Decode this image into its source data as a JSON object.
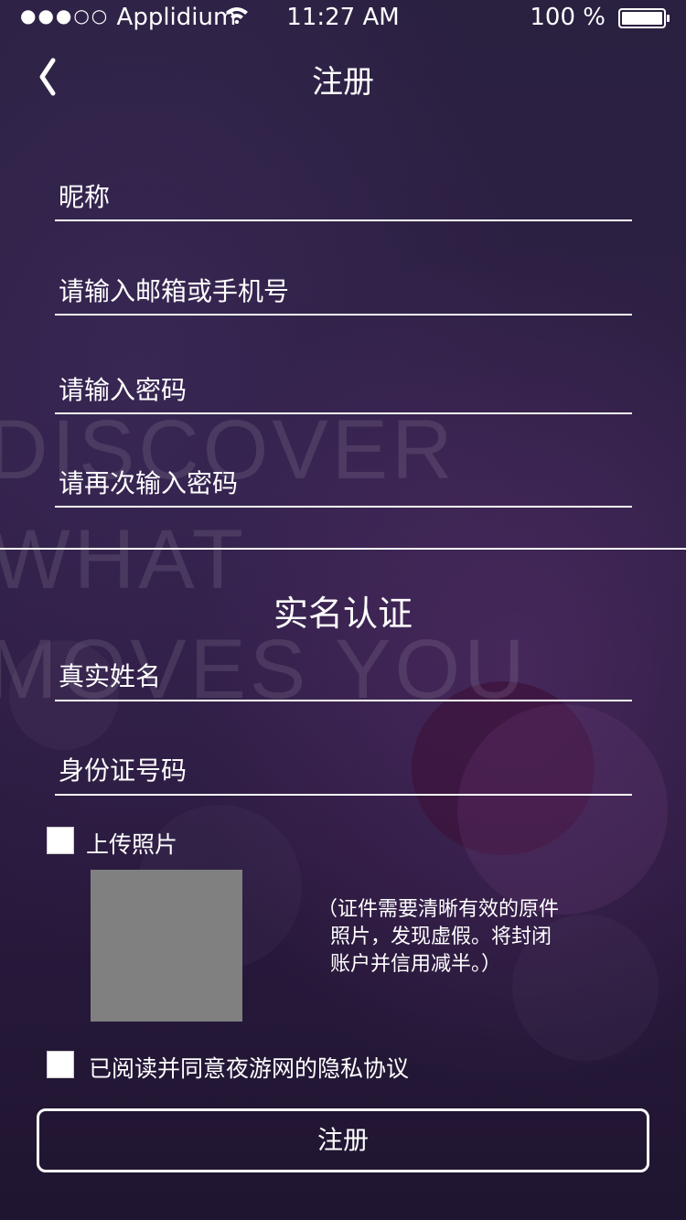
{
  "status_bar": {
    "signal_dots": "●●●○○",
    "carrier": "Applidium",
    "time": "11:27 AM",
    "battery_pct": "100 %",
    "battery_level": 1.0
  },
  "nav": {
    "back_icon": "chevron-left-icon",
    "title": "注册"
  },
  "form": {
    "nickname_placeholder": "昵称",
    "account_placeholder": "请输入邮箱或手机号",
    "password_placeholder": "请输入密码",
    "confirm_password_placeholder": "请再次输入密码"
  },
  "background": {
    "watermark_lines": [
      "DISCOVER",
      "WHAT",
      "MOVES YOU"
    ]
  },
  "verification": {
    "title": "实名认证",
    "real_name_placeholder": "真实姓名",
    "id_number_placeholder": "身份证号码",
    "upload_label": "上传照片",
    "upload_checked": false,
    "note": "（证件需要清晰有效的原件\n  照片，发现虚假。将封闭\n  账户并信用减半。）"
  },
  "agreement": {
    "label": "已阅读并同意夜游网的隐私协议",
    "checked": false
  },
  "submit_label": "注册",
  "colors": {
    "background": "#2e1f45",
    "text": "#ffffff",
    "photo_placeholder": "#808080"
  }
}
